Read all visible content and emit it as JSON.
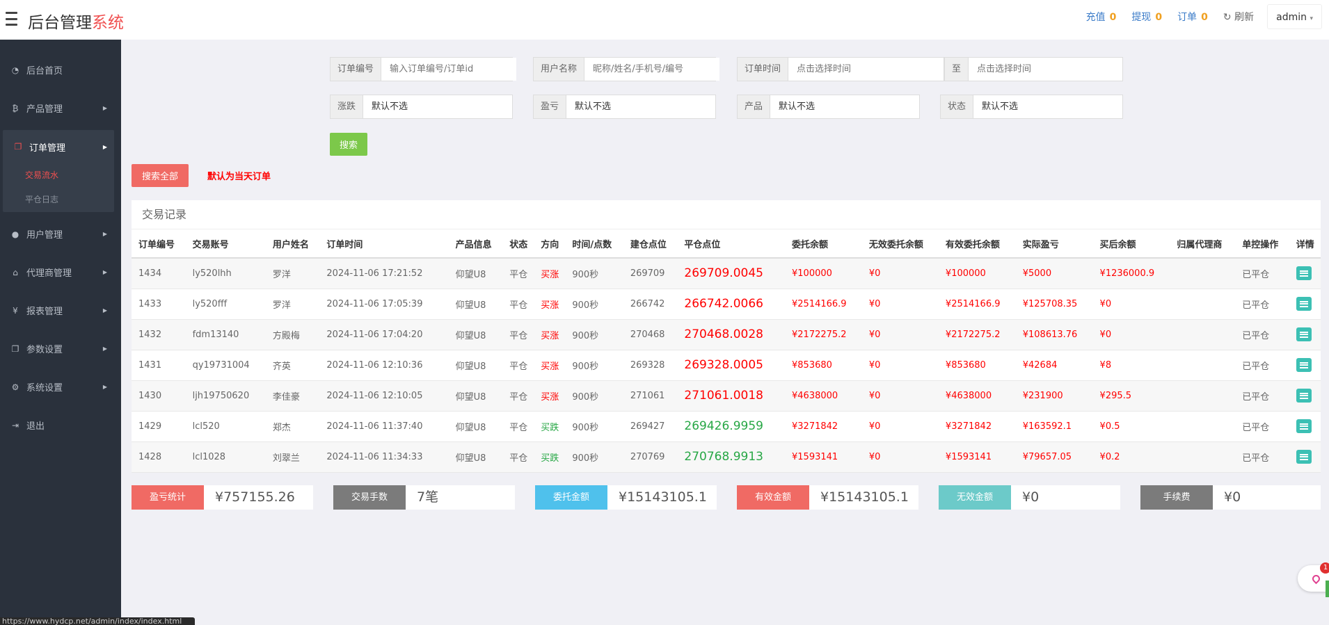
{
  "header": {
    "brand_main": "后台管理",
    "brand_accent": "系统",
    "links": [
      {
        "label": "充值",
        "count": "0"
      },
      {
        "label": "提现",
        "count": "0"
      },
      {
        "label": "订单",
        "count": "0"
      }
    ],
    "refresh_label": "刷新",
    "user": "admin"
  },
  "sidebar": {
    "items": [
      {
        "icon": "dashboard-icon",
        "label": "后台首页"
      },
      {
        "icon": "bitcoin-icon",
        "label": "产品管理"
      },
      {
        "icon": "copy-icon",
        "label": "订单管理"
      },
      {
        "icon": "user-icon",
        "label": "用户管理"
      },
      {
        "icon": "sitemap-icon",
        "label": "代理商管理"
      },
      {
        "icon": "yen-icon",
        "label": "报表管理"
      },
      {
        "icon": "copy-icon",
        "label": "参数设置"
      },
      {
        "icon": "cogs-icon",
        "label": "系统设置"
      },
      {
        "icon": "sign-out-icon",
        "label": "退出"
      }
    ],
    "sub_items": [
      "交易流水",
      "平仓日志"
    ]
  },
  "filters": {
    "order_no": {
      "label": "订单编号",
      "placeholder": "输入订单编号/订单id"
    },
    "user_name": {
      "label": "用户名称",
      "placeholder": "昵称/姓名/手机号/编号"
    },
    "order_time": {
      "label": "订单时间",
      "placeholder": "点击选择时间"
    },
    "to": {
      "label": "至",
      "placeholder": "点击选择时间"
    },
    "updown": {
      "label": "涨跌",
      "value": "默认不选"
    },
    "profit": {
      "label": "盈亏",
      "value": "默认不选"
    },
    "product": {
      "label": "产品",
      "value": "默认不选"
    },
    "status": {
      "label": "状态",
      "value": "默认不选"
    },
    "search_label": "搜索",
    "search_all_label": "搜索全部",
    "hint": "默认为当天订单"
  },
  "table": {
    "title": "交易记录",
    "columns": [
      "订单编号",
      "交易账号",
      "用户姓名",
      "订单时间",
      "产品信息",
      "状态",
      "方向",
      "时间/点数",
      "建仓点位",
      "平仓点位",
      "委托余额",
      "无效委托余额",
      "有效委托余额",
      "实际盈亏",
      "买后余额",
      "归属代理商",
      "单控操作",
      "详情"
    ],
    "rows": [
      {
        "id": "1434",
        "account": "ly520lhh",
        "name": "罗洋",
        "time": "2024-11-06 17:21:52",
        "product": "仰望U8",
        "status": "平仓",
        "dir": "买涨",
        "dir_type": "up",
        "duration": "900秒",
        "open": "269709",
        "close": "269709.0045",
        "amount": "¥100000",
        "invalid": "¥0",
        "valid": "¥100000",
        "pnl": "¥5000",
        "after": "¥1236000.9",
        "agent": "",
        "op": "已平仓"
      },
      {
        "id": "1433",
        "account": "ly520fff",
        "name": "罗洋",
        "time": "2024-11-06 17:05:39",
        "product": "仰望U8",
        "status": "平仓",
        "dir": "买涨",
        "dir_type": "up",
        "duration": "900秒",
        "open": "266742",
        "close": "266742.0066",
        "amount": "¥2514166.9",
        "invalid": "¥0",
        "valid": "¥2514166.9",
        "pnl": "¥125708.35",
        "after": "¥0",
        "agent": "",
        "op": "已平仓"
      },
      {
        "id": "1432",
        "account": "fdm13140",
        "name": "方殿梅",
        "time": "2024-11-06 17:04:20",
        "product": "仰望U8",
        "status": "平仓",
        "dir": "买涨",
        "dir_type": "up",
        "duration": "900秒",
        "open": "270468",
        "close": "270468.0028",
        "amount": "¥2172275.2",
        "invalid": "¥0",
        "valid": "¥2172275.2",
        "pnl": "¥108613.76",
        "after": "¥0",
        "agent": "",
        "op": "已平仓"
      },
      {
        "id": "1431",
        "account": "qy19731004",
        "name": "齐英",
        "time": "2024-11-06 12:10:36",
        "product": "仰望U8",
        "status": "平仓",
        "dir": "买涨",
        "dir_type": "up",
        "duration": "900秒",
        "open": "269328",
        "close": "269328.0005",
        "amount": "¥853680",
        "invalid": "¥0",
        "valid": "¥853680",
        "pnl": "¥42684",
        "after": "¥8",
        "agent": "",
        "op": "已平仓"
      },
      {
        "id": "1430",
        "account": "ljh19750620",
        "name": "李佳豪",
        "time": "2024-11-06 12:10:05",
        "product": "仰望U8",
        "status": "平仓",
        "dir": "买涨",
        "dir_type": "up",
        "duration": "900秒",
        "open": "271061",
        "close": "271061.0018",
        "amount": "¥4638000",
        "invalid": "¥0",
        "valid": "¥4638000",
        "pnl": "¥231900",
        "after": "¥295.5",
        "agent": "",
        "op": "已平仓"
      },
      {
        "id": "1429",
        "account": "lcl520",
        "name": "郑杰",
        "time": "2024-11-06 11:37:40",
        "product": "仰望U8",
        "status": "平仓",
        "dir": "买跌",
        "dir_type": "down",
        "duration": "900秒",
        "open": "269427",
        "close": "269426.9959",
        "amount": "¥3271842",
        "invalid": "¥0",
        "valid": "¥3271842",
        "pnl": "¥163592.1",
        "after": "¥0.5",
        "agent": "",
        "op": "已平仓"
      },
      {
        "id": "1428",
        "account": "lcl1028",
        "name": "刘翠兰",
        "time": "2024-11-06 11:34:33",
        "product": "仰望U8",
        "status": "平仓",
        "dir": "买跌",
        "dir_type": "down",
        "duration": "900秒",
        "open": "270769",
        "close": "270768.9913",
        "amount": "¥1593141",
        "invalid": "¥0",
        "valid": "¥1593141",
        "pnl": "¥79657.05",
        "after": "¥0.2",
        "agent": "",
        "op": "已平仓"
      }
    ]
  },
  "stats": [
    {
      "label": "盈亏统计",
      "value": "¥757155.26",
      "color": "#f06a64"
    },
    {
      "label": "交易手数",
      "value": "7笔",
      "color": "#7b7b7b"
    },
    {
      "label": "委托金额",
      "value": "¥15143105.1",
      "color": "#4fc1ec"
    },
    {
      "label": "有效金额",
      "value": "¥15143105.1",
      "color": "#f06a64"
    },
    {
      "label": "无效金额",
      "value": "¥0",
      "color": "#6ccac9"
    },
    {
      "label": "手续费",
      "value": "¥0",
      "color": "#7b7b7b"
    }
  ],
  "statusbar": "https://www.hydcp.net/admin/index/index.html",
  "widget_badge": "1"
}
